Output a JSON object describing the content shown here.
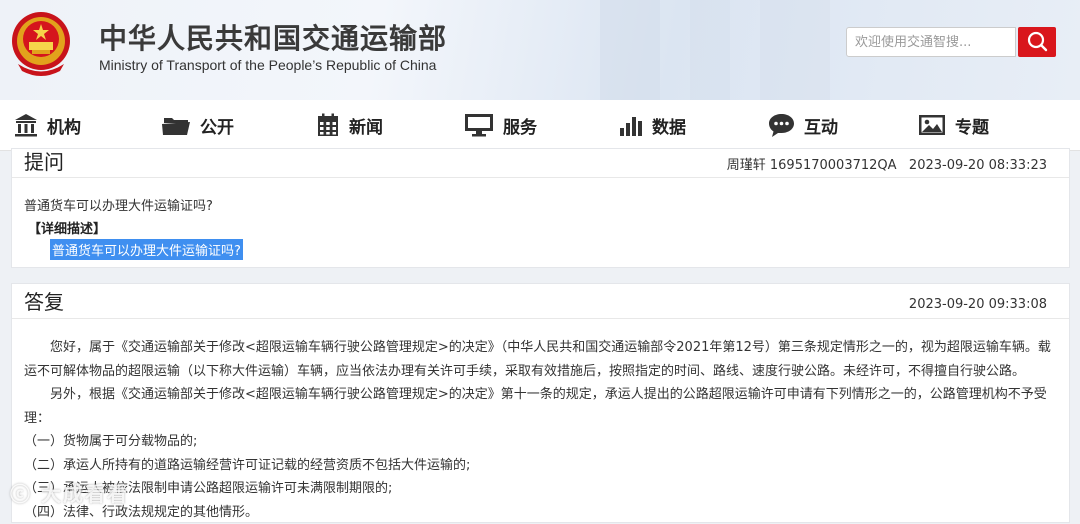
{
  "header": {
    "title_cn": "中华人民共和国交通运输部",
    "title_en": "Ministry of Transport of the People’s Republic of China",
    "search_placeholder": "欢迎使用交通智搜..."
  },
  "nav": [
    {
      "label": "机构",
      "icon": "building-icon"
    },
    {
      "label": "公开",
      "icon": "folder-icon"
    },
    {
      "label": "新闻",
      "icon": "calendar-icon"
    },
    {
      "label": "服务",
      "icon": "monitor-icon"
    },
    {
      "label": "数据",
      "icon": "bar-chart-icon"
    },
    {
      "label": "互动",
      "icon": "chat-bubble-icon"
    },
    {
      "label": "专题",
      "icon": "image-icon"
    }
  ],
  "question": {
    "heading": "提问",
    "meta": "周瑾轩 1695170003712QA   2023-09-20 08:33:23",
    "text": "普通货车可以办理大件运输证吗?",
    "detail_label": "【详细描述】",
    "detail_text": "普通货车可以办理大件运输证吗?"
  },
  "answer": {
    "heading": "答复",
    "meta": "2023-09-20 09:33:08",
    "paragraphs": [
      "您好，属于《交通运输部关于修改<超限运输车辆行驶公路管理规定>的决定》（中华人民共和国交通运输部令2021年第12号）第三条规定情形之一的，视为超限运输车辆。载运不可解体物品的超限运输（以下称大件运输）车辆，应当依法办理有关许可手续，采取有效措施后，按照指定的时间、路线、速度行驶公路。未经许可，不得擅自行驶公路。",
      "另外，根据《交通运输部关于修改<超限运输车辆行驶公路管理规定>的决定》第十一条的规定，承运人提出的公路超限运输许可申请有下列情形之一的，公路管理机构不予受理："
    ],
    "items": [
      "（一）货物属于可分载物品的;",
      "（二）承运人所持有的道路运输经营许可证记载的经营资质不包括大件运输的;",
      "（三）承运人被依法限制申请公路超限运输许可未满限制期限的;",
      "（四）法律、行政法规规定的其他情形。"
    ]
  },
  "watermark": "大成看看",
  "colors": {
    "accent_red": "#d9161c",
    "highlight_blue": "#3f8ff0"
  }
}
